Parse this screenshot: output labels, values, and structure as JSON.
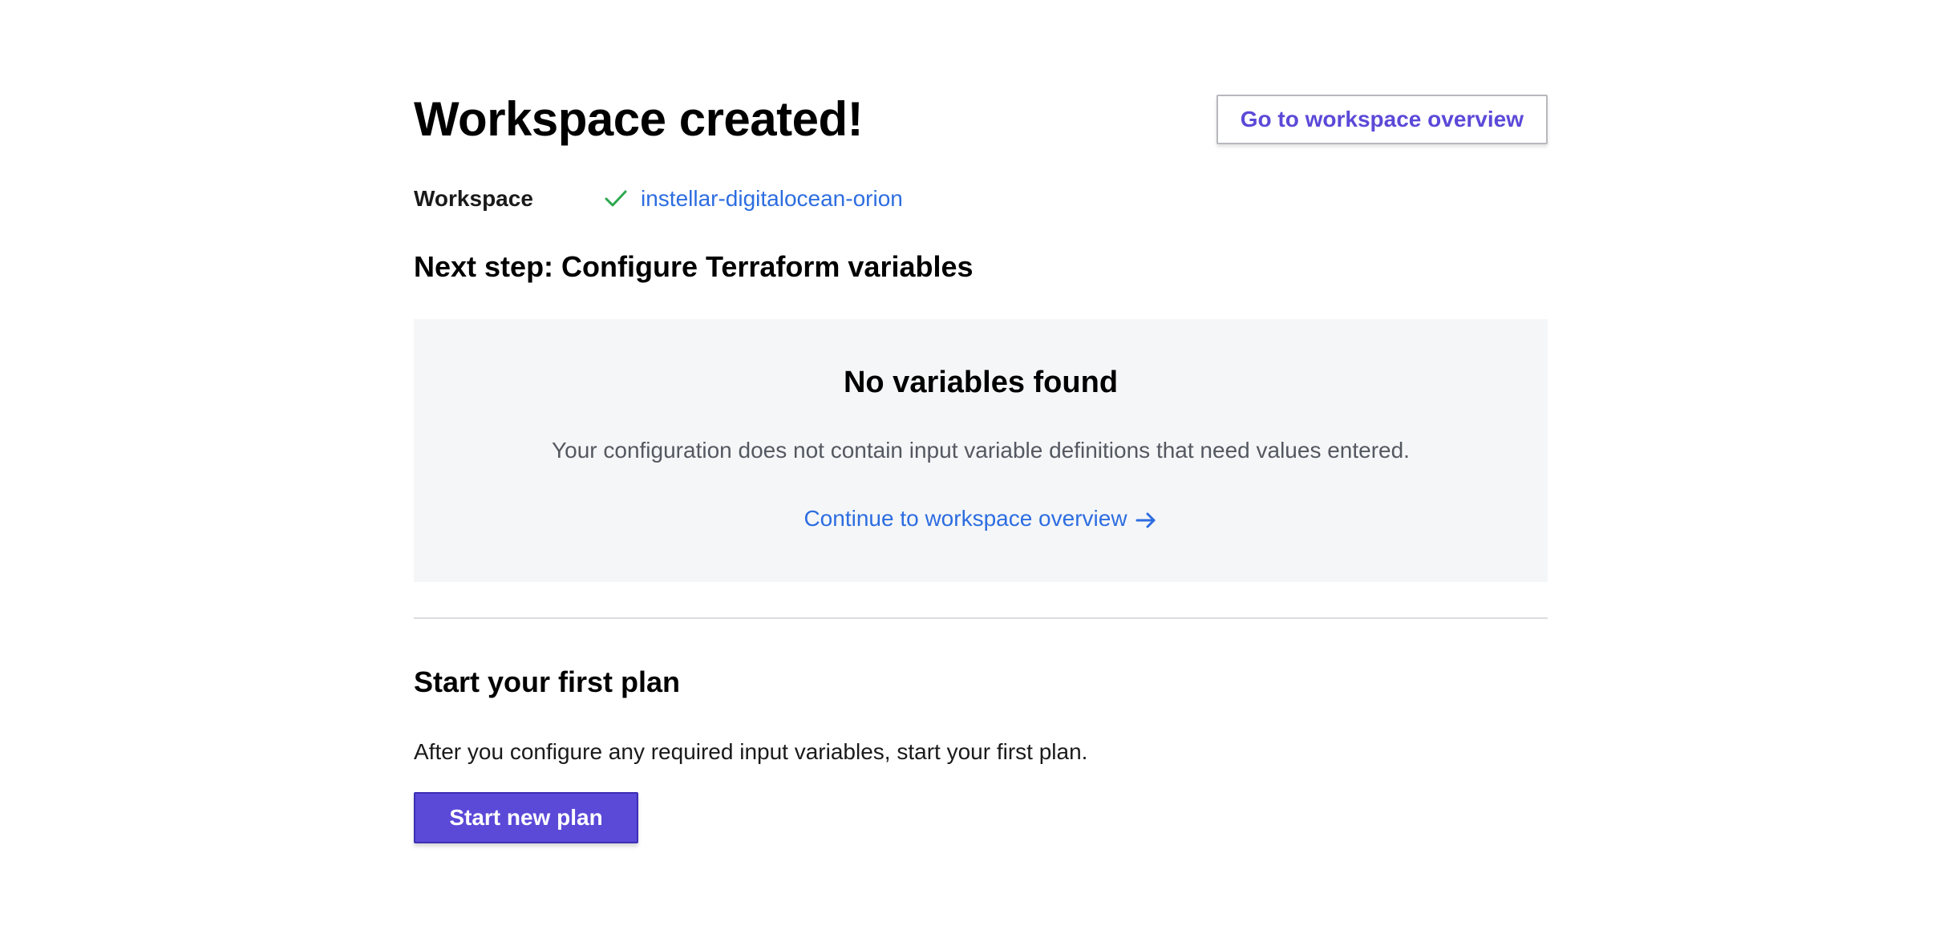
{
  "header": {
    "title": "Workspace created!",
    "overview_button_label": "Go to workspace overview"
  },
  "workspace": {
    "label": "Workspace",
    "status_icon": "check-icon",
    "name": "instellar-digitalocean-orion"
  },
  "next_step": {
    "title": "Next step: Configure Terraform variables",
    "empty_state": {
      "title": "No variables found",
      "description": "Your configuration does not contain input variable definitions that need values entered.",
      "continue_link_label": "Continue to workspace overview",
      "continue_icon": "arrow-right-icon"
    }
  },
  "first_plan": {
    "title": "Start your first plan",
    "description": "After you configure any required input variables, start your first plan.",
    "button_label": "Start new plan"
  },
  "colors": {
    "accent": "#5b49d8",
    "link": "#2d6de0",
    "success": "#2fa84f",
    "panel_background": "#f5f6f8"
  }
}
